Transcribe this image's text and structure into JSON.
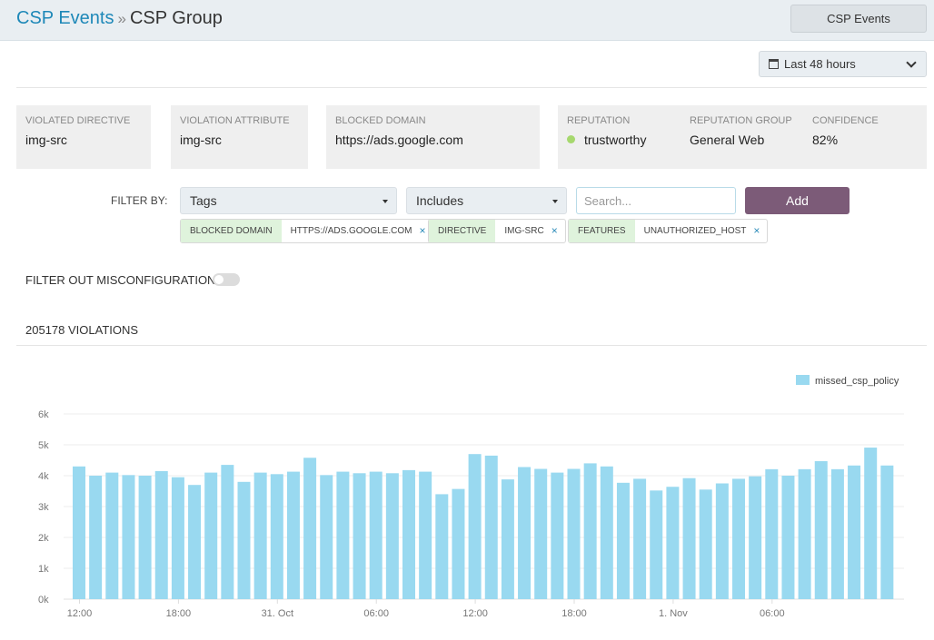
{
  "header": {
    "breadcrumb_parent": "CSP Events",
    "breadcrumb_separator": "»",
    "breadcrumb_current": "CSP Group",
    "top_button": "CSP Events"
  },
  "time_range": {
    "label": "Last 48 hours",
    "icon": "calendar-icon"
  },
  "cards": {
    "violated_directive": {
      "label": "VIOLATED DIRECTIVE",
      "value": "img-src"
    },
    "violation_attribute": {
      "label": "VIOLATION ATTRIBUTE",
      "value": "img-src"
    },
    "blocked_domain": {
      "label": "BLOCKED DOMAIN",
      "value": "https://ads.google.com"
    },
    "reputation": {
      "label": "REPUTATION",
      "value": "trustworthy",
      "status_color": "#a6d86e"
    },
    "reputation_group": {
      "label": "REPUTATION GROUP",
      "value": "General Web"
    },
    "confidence": {
      "label": "CONFIDENCE",
      "value": "82%"
    }
  },
  "filter": {
    "label": "FILTER BY:",
    "field_select": "Tags",
    "operator_select": "Includes",
    "search_placeholder": "Search...",
    "add_label": "Add",
    "tags": [
      {
        "key": "BLOCKED DOMAIN",
        "value": "HTTPS://ADS.GOOGLE.COM",
        "remove": "×"
      },
      {
        "key": "DIRECTIVE",
        "value": "IMG-SRC",
        "remove": "×"
      },
      {
        "key": "FEATURES",
        "value": "UNAUTHORIZED_HOST",
        "remove": "×"
      }
    ]
  },
  "misconfig_toggle": {
    "label": "FILTER OUT MISCONFIGURATIONS",
    "on": false
  },
  "violations_count": "205178 VIOLATIONS",
  "chart_data": {
    "type": "bar",
    "title": "",
    "xlabel": "",
    "ylabel": "",
    "ylim": [
      0,
      6000
    ],
    "yticks": [
      "0k",
      "1k",
      "2k",
      "3k",
      "4k",
      "5k",
      "6k"
    ],
    "xtick_labels": [
      "12:00",
      "18:00",
      "31. Oct",
      "06:00",
      "12:00",
      "18:00",
      "1. Nov",
      "06:00"
    ],
    "xtick_bar_index": [
      0.5,
      6.5,
      12.5,
      18.5,
      24.5,
      30.5,
      36.5,
      42.5
    ],
    "grid": true,
    "legend_position": "top-right",
    "series": [
      {
        "name": "missed_csp_policy",
        "color": "#99d9f0",
        "values": [
          4300,
          4000,
          4100,
          4020,
          4000,
          4150,
          3950,
          3700,
          4100,
          4350,
          3800,
          4100,
          4050,
          4130,
          4580,
          4020,
          4130,
          4080,
          4130,
          4080,
          4180,
          4130,
          3400,
          3570,
          4700,
          4650,
          3880,
          4280,
          4220,
          4100,
          4220,
          4400,
          4300,
          3770,
          3900,
          3520,
          3640,
          3920,
          3550,
          3750,
          3900,
          3980,
          4210,
          4000,
          4210,
          4470,
          4210,
          4330,
          4910,
          4330
        ]
      }
    ]
  }
}
